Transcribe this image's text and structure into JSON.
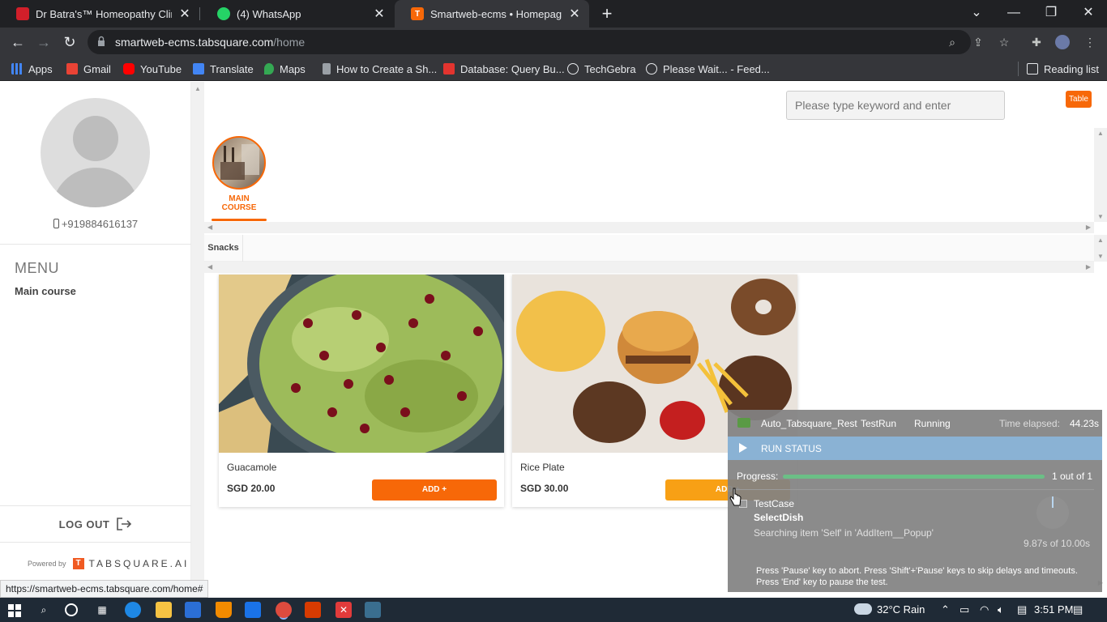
{
  "browser": {
    "tabs": [
      {
        "label": "Dr Batra's™ Homeopathy Clinics |",
        "favicon_color": "#d11f2a",
        "active": false
      },
      {
        "label": "(4) WhatsApp",
        "favicon_color": "#25d366",
        "active": false
      },
      {
        "label": "Smartweb-ecms • Homepage",
        "favicon_color": "#f76808",
        "active": true
      }
    ],
    "url_host": "smartweb-ecms.tabsquare.com",
    "url_path": "/home",
    "bookmarks": [
      {
        "label": "Apps",
        "icon": "apps-grid-icon",
        "color": "#4285f4"
      },
      {
        "label": "Gmail",
        "icon": "gmail-icon",
        "color": "#ea4335"
      },
      {
        "label": "YouTube",
        "icon": "youtube-icon",
        "color": "#ff0000"
      },
      {
        "label": "Translate",
        "icon": "translate-icon",
        "color": "#4285f4"
      },
      {
        "label": "Maps",
        "icon": "maps-icon",
        "color": "#34a853"
      },
      {
        "label": "How to Create a Sh...",
        "icon": "page-icon",
        "color": "#9aa0a6"
      },
      {
        "label": "Database: Query Bu...",
        "icon": "laravel-icon",
        "color": "#e3342f"
      },
      {
        "label": "TechGebra",
        "icon": "globe-icon",
        "color": "#e8eaed"
      },
      {
        "label": "Please Wait... - Feed...",
        "icon": "globe-icon",
        "color": "#e8eaed"
      }
    ],
    "reading_list": "Reading list",
    "status_url": "https://smartweb-ecms.tabsquare.com/home#"
  },
  "sidebar": {
    "phone": "+919884616137",
    "menu_title": "MENU",
    "menu_item": "Main course",
    "logout": "LOG OUT",
    "powered_by": "Powered by",
    "brand": "TABSQUARE.AI"
  },
  "header": {
    "search_placeholder": "Please type keyword and enter",
    "table_badge": "Table"
  },
  "category": {
    "label": "MAIN COURSE"
  },
  "subcategory": {
    "label": "Snacks"
  },
  "products": [
    {
      "name": "Guacamole",
      "price": "SGD 20.00",
      "button": "ADD +"
    },
    {
      "name": "Rice Plate",
      "price": "SGD 30.00",
      "button": "ADD +"
    }
  ],
  "runner": {
    "name": "Auto_Tabsquare_Rest",
    "run_type": "TestRun",
    "state": "Running",
    "elapsed_label": "Time elapsed:",
    "elapsed": "44.23s",
    "status_title": "RUN STATUS",
    "progress_label": "Progress:",
    "progress_count": "1 out of 1",
    "progress_fraction": 1.0,
    "testcase": "TestCase",
    "step": "SelectDish",
    "message": "Searching item 'Self' in 'AddItem__Popup'",
    "step_time": "9.87s of 10.00s",
    "help": "Press 'Pause' key to abort. Press 'Shift'+'Pause' keys to skip delays and timeouts. Press 'End' key to pause the test."
  },
  "taskbar": {
    "weather": "32°C  Rain",
    "time": "3:51 PM"
  },
  "colors": {
    "accent": "#f76808",
    "chrome_dark": "#202124",
    "chrome_mid": "#35363a"
  }
}
